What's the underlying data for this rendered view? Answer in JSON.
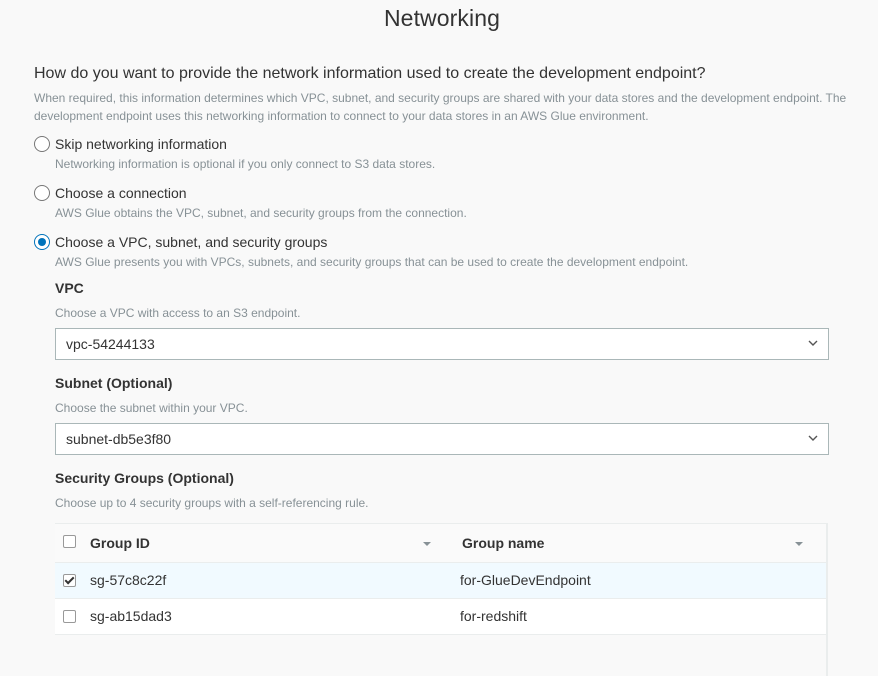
{
  "page": {
    "title": "Networking",
    "question": "How do you want to provide the network information used to create the development endpoint?",
    "intro": "When required, this information determines which VPC, subnet, and security groups are shared with your data stores and the development endpoint. The development endpoint uses this networking information to connect to your data stores in an AWS Glue environment."
  },
  "options": [
    {
      "label": "Skip networking information",
      "description": "Networking information is optional if you only connect to S3 data stores.",
      "selected": false
    },
    {
      "label": "Choose a connection",
      "description": "AWS Glue obtains the VPC, subnet, and security groups from the connection.",
      "selected": false
    },
    {
      "label": "Choose a VPC, subnet, and security groups",
      "description": "AWS Glue presents you with VPCs, subnets, and security groups that can be used to create the development endpoint.",
      "selected": true
    }
  ],
  "vpc": {
    "label": "VPC",
    "help": "Choose a VPC with access to an S3 endpoint.",
    "value": "vpc-54244133"
  },
  "subnet": {
    "label": "Subnet (Optional)",
    "help": "Choose the subnet within your VPC.",
    "value": "subnet-db5e3f80"
  },
  "security_groups": {
    "label": "Security Groups (Optional)",
    "help": "Choose up to 4 security groups with a self-referencing rule.",
    "columns": [
      "Group ID",
      "Group name"
    ],
    "rows": [
      {
        "group_id": "sg-57c8c22f",
        "group_name": "for-GlueDevEndpoint",
        "checked": true
      },
      {
        "group_id": "sg-ab15dad3",
        "group_name": "for-redshift",
        "checked": false
      }
    ]
  },
  "colors": {
    "accent": "#0073bb",
    "muted_text": "#879196",
    "selected_row": "#f1faff"
  },
  "icons": {
    "select_arrow": "chevron-down-icon",
    "sort": "sort-caret-icon"
  }
}
